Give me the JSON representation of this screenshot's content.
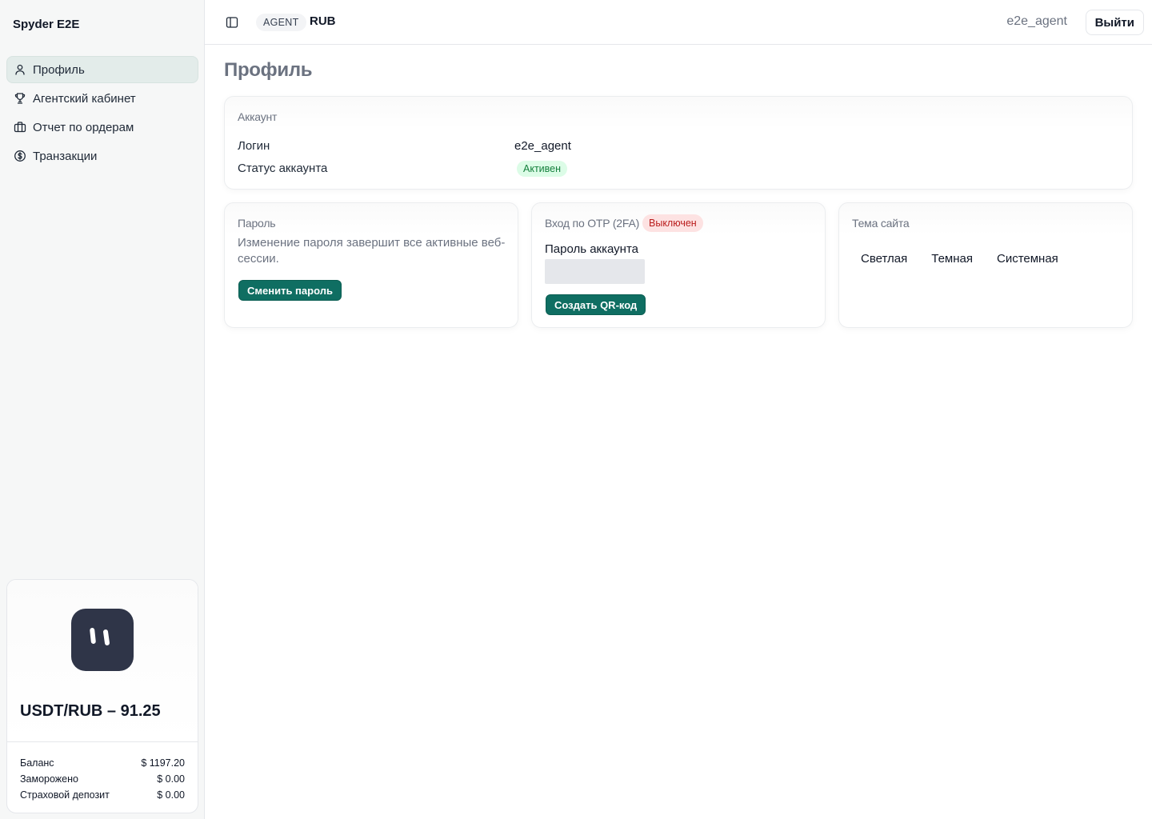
{
  "app": {
    "brand": "Spyder E2E"
  },
  "sidebar": {
    "items": [
      {
        "label": "Профиль",
        "icon": "user-icon",
        "active": true
      },
      {
        "label": "Агентский кабинет",
        "icon": "trophy-icon",
        "active": false
      },
      {
        "label": "Отчет по ордерам",
        "icon": "briefcase-icon",
        "active": false
      },
      {
        "label": "Транзакции",
        "icon": "dollar-circle-icon",
        "active": false
      }
    ],
    "rate_card": {
      "title": "USDT/RUB – 91.25",
      "rows": [
        {
          "label": "Баланс",
          "value": "$ 1197.20"
        },
        {
          "label": "Заморожено",
          "value": "$ 0.00"
        },
        {
          "label": "Страховой депозит",
          "value": "$ 0.00"
        }
      ]
    }
  },
  "header": {
    "role": "AGENT",
    "currency": "RUB",
    "username": "e2e_agent",
    "logout_label": "Выйти"
  },
  "main": {
    "title": "Профиль",
    "account": {
      "title": "Аккаунт",
      "login_label": "Логин",
      "login_value": "e2e_agent",
      "status_label": "Статус аккаунта",
      "status_value": "Активен"
    },
    "password": {
      "title": "Пароль",
      "description": "Изменение пароля завершит все активные веб-сессии.",
      "button_label": "Сменить пароль"
    },
    "otp": {
      "title": "Вход по OTP (2FA)",
      "status": "Выключен",
      "field_label": "Пароль аккаунта",
      "field_value": "",
      "button_label": "Создать QR-код"
    },
    "theme": {
      "title": "Тема сайта",
      "options": [
        "Светлая",
        "Темная",
        "Системная"
      ]
    }
  },
  "colors": {
    "primary": "#0f6e62",
    "active_nav": "#e3ecea",
    "success_bg": "#dcfce7",
    "success_text": "#15803d",
    "danger_bg": "#fde2e2",
    "danger_text": "#b91c1c",
    "logo_bg": "#2f3548"
  }
}
